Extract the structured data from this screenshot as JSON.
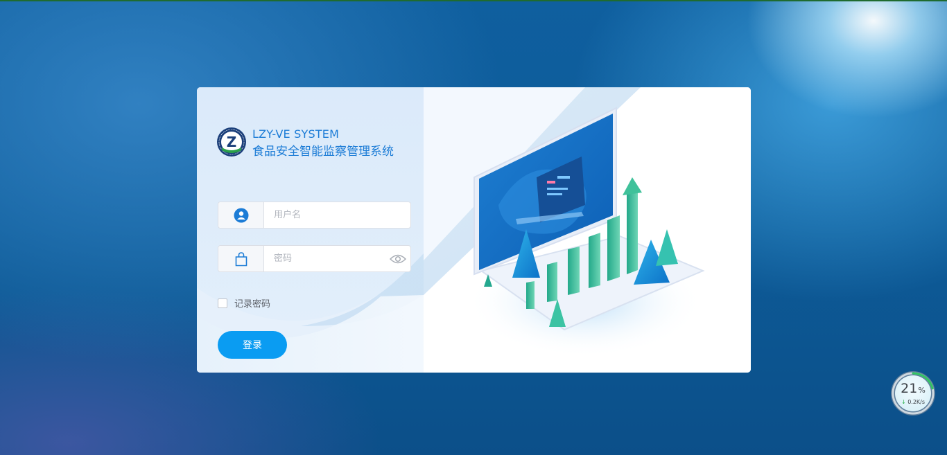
{
  "brand": {
    "title": "LZY-VE SYSTEM",
    "subtitle": "食品安全智能监察管理系统",
    "logo_letter": "Z",
    "primary_color": "#1c7cd6"
  },
  "login_form": {
    "username": {
      "placeholder": "用户名",
      "value": "",
      "icon": "user-icon"
    },
    "password": {
      "placeholder": "密码",
      "value": "",
      "icon": "bag-lock-icon",
      "toggle_icon": "eye-icon"
    },
    "remember_label": "记录密码",
    "remember_checked": false,
    "submit_label": "登录",
    "button_color": "#0a9cf2"
  },
  "speed_widget": {
    "percent": "21",
    "percent_unit": "%",
    "arrow": "↓",
    "rate": "0.2K/s",
    "ring_fraction": 0.21
  }
}
